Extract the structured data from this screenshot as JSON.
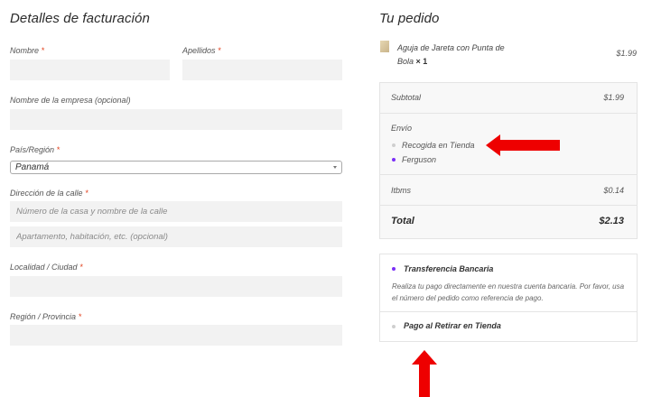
{
  "billing": {
    "title": "Detalles de facturación",
    "first_name_label": "Nombre",
    "last_name_label": "Apellidos",
    "company_label": "Nombre de la empresa (opcional)",
    "country_label": "País/Región",
    "country_value": "Panamá",
    "address_label": "Dirección de la calle",
    "address1_placeholder": "Número de la casa y nombre de la calle",
    "address2_placeholder": "Apartamento, habitación, etc. (opcional)",
    "city_label": "Localidad / Ciudad",
    "region_label": "Región / Provincia",
    "required_mark": "*"
  },
  "order": {
    "title": "Tu pedido",
    "product": {
      "name": "Aguja de Jareta con Punta de Bola",
      "qty": "× 1",
      "price": "$1.99"
    },
    "subtotal_label": "Subtotal",
    "subtotal_value": "$1.99",
    "shipping_label": "Envío",
    "shipping_options": [
      {
        "label": "Recogida en Tienda",
        "selected": false
      },
      {
        "label": "Ferguson",
        "selected": true
      }
    ],
    "tax_label": "Itbms",
    "tax_value": "$0.14",
    "total_label": "Total",
    "total_value": "$2.13"
  },
  "payment": {
    "methods": [
      {
        "label": "Transferencia Bancaria",
        "selected": true
      },
      {
        "label": "Pago al Retirar en Tienda",
        "selected": false
      }
    ],
    "bank_description": "Realiza tu pago directamente en nuestra cuenta bancaria. Por favor, usa el número del pedido como referencia de pago."
  },
  "colors": {
    "accent": "#7b2ff7",
    "required": "#e2401c",
    "arrow": "#ee0000"
  }
}
